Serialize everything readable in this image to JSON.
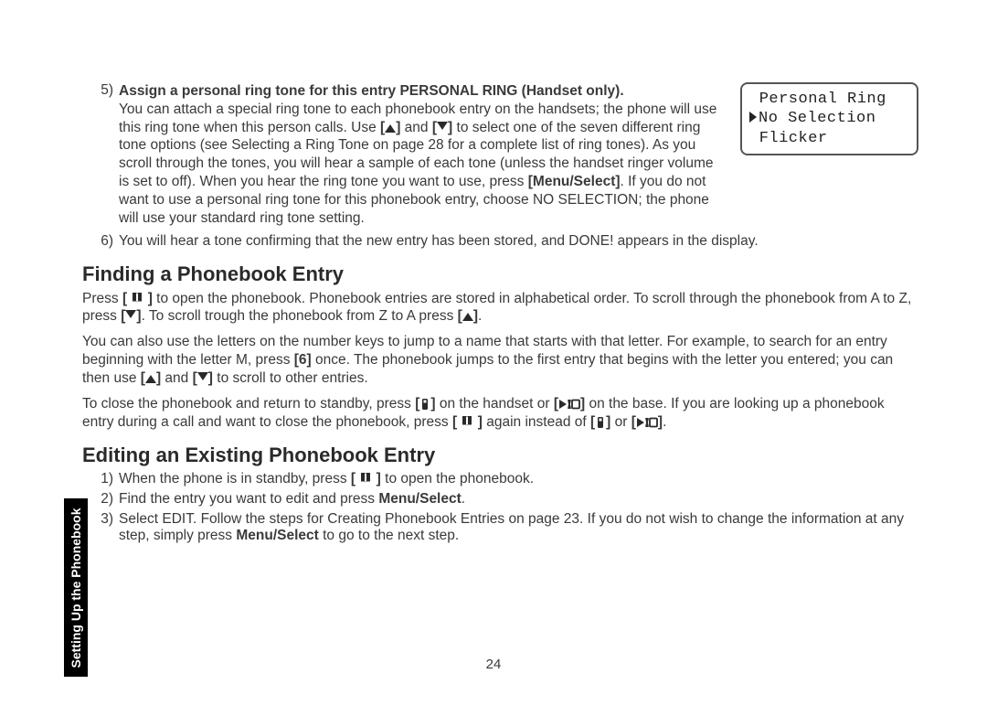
{
  "step5": {
    "num": "5)",
    "title": "Assign a personal ring tone for this entry PERSONAL RING (Handset only).",
    "p1a": "You can attach a special ring tone to each phonebook entry on the handsets; the phone will use this ring tone when this person calls. Use ",
    "p1b": " and ",
    "p1c": " to select one of the seven different ring tone options (see Selecting a Ring Tone on page 28 for a complete list of ring tones). As you scroll through the tones, you will hear a sample of each tone (unless the handset ringer volume is set to off). When you hear the ring tone you want to use, press ",
    "menuSelect": "[Menu/Select]",
    "p1d": ". If you do not want to use a personal ring tone for this phonebook entry, choose NO SELECTION; the phone will use your standard ring tone setting."
  },
  "lcd": {
    "l1": " Personal Ring",
    "l2": "No Selection",
    "l3": " Flicker"
  },
  "step6": {
    "num": "6)",
    "text": "You will hear a tone confirming that the new entry has been stored, and DONE! appears in the display."
  },
  "finding": {
    "heading": "Finding a Phonebook Entry",
    "p1a": "Press ",
    "p1b": " to open the phonebook. Phonebook entries are stored in alphabetical order. To scroll through the phonebook from A to Z, press ",
    "p1c": ". To scroll trough the phonebook from Z to A press ",
    "p1d": ".",
    "p2a": "You can also use the letters on the number keys to jump to a name that starts with that letter. For example, to search for an entry beginning with the letter M, press ",
    "six": "[6]",
    "p2b": " once. The phonebook jumps to the first entry that begins with the letter you entered; you can then use ",
    "p2c": " and ",
    "p2d": " to scroll to other entries.",
    "p3a": "To close the phonebook and return to standby, press ",
    "p3b": " on the handset or ",
    "p3c": " on the base. If you are looking up a phonebook entry during a call and want to close the phonebook, press ",
    "p3d": " again instead of ",
    "p3e": " or ",
    "p3f": "."
  },
  "editing": {
    "heading": "Editing an Existing Phonebook Entry",
    "s1num": "1)",
    "s1a": "When the phone is in standby, press ",
    "s1b": " to open the phonebook.",
    "s2num": "2)",
    "s2": "Find the entry you want to edit and press ",
    "s2b": ".",
    "s3num": "3)",
    "s3a": "Select EDIT. Follow the steps for Creating Phonebook Entries on page 23. If you do not wish to change the information at any step, simply press ",
    "s3b": " to go to the next step."
  },
  "labels": {
    "menuSelect": "Menu/Select"
  },
  "sideTab": "Setting Up the Phonebook",
  "pageNum": "24"
}
